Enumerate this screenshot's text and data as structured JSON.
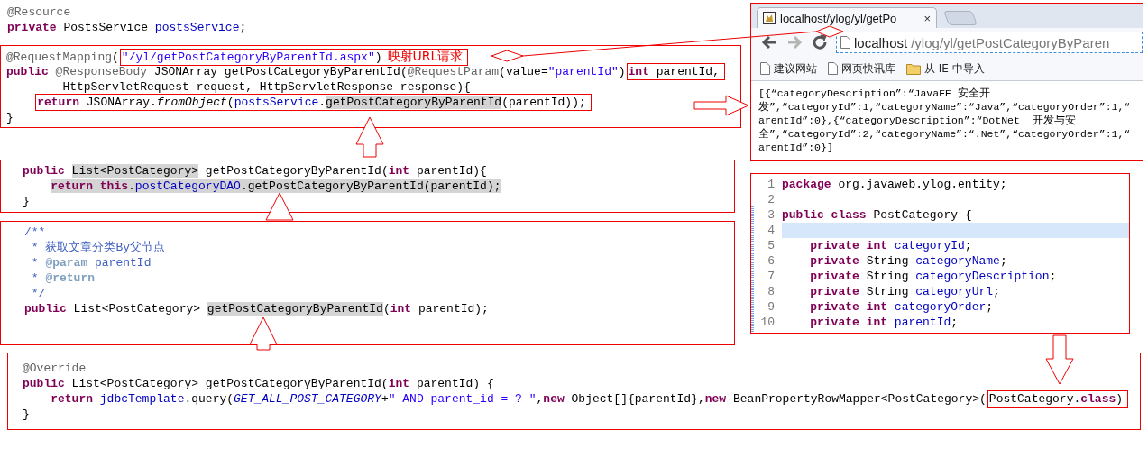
{
  "panels": [
    {
      "framed": false,
      "lines": [
        {
          "indented": false,
          "tokens": [
            {
              "text": "@Resource",
              "kind": "ann"
            }
          ]
        },
        {
          "indented": false,
          "tokens": [
            {
              "text": "private",
              "kind": "kw"
            },
            {
              "text": " PostsService ",
              "kind": "plain"
            },
            {
              "text": "postsService",
              "kind": "field"
            },
            {
              "text": ";",
              "kind": "plain"
            }
          ]
        }
      ]
    },
    {
      "framed": true,
      "lines": [
        {
          "indented": false,
          "tokens": [
            {
              "text": "@RequestMapping",
              "kind": "ann"
            },
            {
              "text": "(",
              "kind": "plain"
            },
            {
              "kind": "frame",
              "tokens": [
                {
                  "text": "\"/yl/getPostCategoryByParentId.aspx\"",
                  "kind": "str"
                },
                {
                  "text": ")",
                  "kind": "plain"
                },
                {
                  "text": "映射URL请求",
                  "kind": "note"
                }
              ]
            }
          ]
        },
        {
          "indented": false,
          "tokens": [
            {
              "text": "public ",
              "kind": "kw"
            },
            {
              "text": "@ResponseBody",
              "kind": "ann"
            },
            {
              "text": " JSONArray getPostCategoryByParentId(",
              "kind": "plain"
            },
            {
              "text": "@RequestParam",
              "kind": "ann"
            },
            {
              "text": "(value=",
              "kind": "plain"
            },
            {
              "text": "\"parentId\"",
              "kind": "str"
            },
            {
              "text": ")",
              "kind": "plain"
            },
            {
              "kind": "frame",
              "tokens": [
                {
                  "text": "int",
                  "kind": "kw"
                },
                {
                  "text": " parentId,",
                  "kind": "plain"
                }
              ]
            }
          ]
        },
        {
          "indented": false,
          "tokens": [
            {
              "text": "        HttpServletRequest request, HttpServletResponse response){",
              "kind": "plain"
            }
          ]
        },
        {
          "indented": true,
          "tokens": [
            {
              "kind": "frame",
              "tokens": [
                {
                  "text": "return",
                  "kind": "kw"
                },
                {
                  "text": " JSONArray.",
                  "kind": "plain"
                },
                {
                  "text": "fromObject",
                  "kind": "ital"
                },
                {
                  "text": "(",
                  "kind": "plain"
                },
                {
                  "text": "postsService",
                  "kind": "field"
                },
                {
                  "text": ".",
                  "kind": "plain"
                },
                {
                  "text": "getPostCategoryByParentId",
                  "kind": "mark"
                },
                {
                  "text": "(parentId));",
                  "kind": "plain"
                }
              ]
            }
          ]
        },
        {
          "indented": false,
          "tokens": [
            {
              "text": "}",
              "kind": "plain"
            }
          ]
        }
      ]
    },
    {
      "framed": true,
      "lines": [
        {
          "indented": false,
          "tokens": [
            {
              "text": "public ",
              "kind": "kw"
            },
            {
              "text": "List<PostCategory>",
              "kind": "mark"
            },
            {
              "text": " getPostCategoryByParentId(",
              "kind": "plain"
            },
            {
              "text": "int",
              "kind": "kw"
            },
            {
              "text": " parentId){",
              "kind": "plain"
            }
          ]
        },
        {
          "indented": true,
          "tokens": [
            {
              "text": "return this",
              "kind": "markkw"
            },
            {
              "text": ".",
              "kind": "mark"
            },
            {
              "text": "postCategoryDAO",
              "kind": "markfield"
            },
            {
              "text": ".getPostCategoryByParentId(parentId);",
              "kind": "mark"
            }
          ]
        },
        {
          "indented": false,
          "tokens": [
            {
              "text": "}",
              "kind": "plain"
            }
          ]
        }
      ]
    },
    {
      "framed": true,
      "lines": [
        {
          "indented": false,
          "tokens": [
            {
              "text": "/**",
              "kind": "cmt"
            }
          ]
        },
        {
          "indented": false,
          "tokens": [
            {
              "text": " * 获取文章分类By父节点",
              "kind": "cmt"
            }
          ]
        },
        {
          "indented": false,
          "tokens": [
            {
              "text": " * ",
              "kind": "cmt"
            },
            {
              "text": "@param",
              "kind": "tag"
            },
            {
              "text": " parentId",
              "kind": "cmt"
            }
          ]
        },
        {
          "indented": false,
          "tokens": [
            {
              "text": " * ",
              "kind": "cmt"
            },
            {
              "text": "@return",
              "kind": "tag"
            }
          ]
        },
        {
          "indented": false,
          "tokens": [
            {
              "text": " */",
              "kind": "cmt"
            }
          ]
        },
        {
          "indented": false,
          "tokens": [
            {
              "text": "public",
              "kind": "kw"
            },
            {
              "text": " List<PostCategory> ",
              "kind": "plain"
            },
            {
              "text": "getPostCategoryByParentId",
              "kind": "mark"
            },
            {
              "text": "(",
              "kind": "plain"
            },
            {
              "text": "int",
              "kind": "kw"
            },
            {
              "text": " parentId);",
              "kind": "plain"
            }
          ]
        }
      ]
    },
    {
      "framed": true,
      "lines": [
        {
          "indented": false,
          "tokens": [
            {
              "text": "@Override",
              "kind": "ann"
            }
          ]
        },
        {
          "indented": false,
          "tokens": [
            {
              "text": "public",
              "kind": "kw"
            },
            {
              "text": " List<PostCategory> getPostCategoryByParentId(",
              "kind": "plain"
            },
            {
              "text": "int",
              "kind": "kw"
            },
            {
              "text": " parentId) {",
              "kind": "plain"
            }
          ]
        },
        {
          "indented": true,
          "tokens": [
            {
              "text": "return ",
              "kind": "kw"
            },
            {
              "text": "jdbcTemplate",
              "kind": "field"
            },
            {
              "text": ".query(",
              "kind": "plain"
            },
            {
              "text": "GET_ALL_POST_CATEGORY",
              "kind": "const"
            },
            {
              "text": "+",
              "kind": "plain"
            },
            {
              "text": "\" AND parent_id = ? \"",
              "kind": "str"
            },
            {
              "text": ",",
              "kind": "plain"
            },
            {
              "text": "new",
              "kind": "kw"
            },
            {
              "text": " Object[]{parentId},",
              "kind": "plain"
            },
            {
              "text": "new",
              "kind": "kw"
            },
            {
              "text": " BeanPropertyRowMapper<PostCategory>(",
              "kind": "plain"
            },
            {
              "kind": "frame",
              "tokens": [
                {
                  "text": "PostCategory.",
                  "kind": "plain"
                },
                {
                  "text": "class",
                  "kind": "kw"
                },
                {
                  "text": ")",
                  "kind": "plain"
                }
              ]
            }
          ]
        },
        {
          "indented": false,
          "tokens": [
            {
              "text": "}",
              "kind": "plain"
            }
          ]
        }
      ]
    }
  ],
  "browser": {
    "tab_title": "localhost/ylog/yl/getPo",
    "tab_close": "×",
    "nav_buttons": [
      {
        "kind": "back",
        "disabled": false
      },
      {
        "kind": "forward",
        "disabled": true
      },
      {
        "kind": "reload",
        "disabled": false
      }
    ],
    "address_host": "localhost",
    "address_path": "/ylog/yl/getPostCategoryByParen",
    "bookmarks": [
      {
        "label": "建议网站",
        "kind": "page"
      },
      {
        "label": "网页快讯库",
        "kind": "page"
      },
      {
        "label": "从 IE 中导入",
        "kind": "folder"
      }
    ],
    "content_lines": [
      "[{“categoryDescription”:“JavaEE 安全开",
      "发”,“categoryId”:1,“categoryName”:“Java”,“categoryOrder”:1,“",
      "arentId”:0},{“categoryDescription”:“DotNet  开发与安",
      "全”,“categoryId”:2,“categoryName”:“.Net”,“categoryOrder”:1,“",
      "arentId”:0}]"
    ]
  },
  "editor": {
    "lines": [
      {
        "number": "1",
        "current": false,
        "tokens": [
          {
            "text": "package",
            "kind": "kw"
          },
          {
            "text": " org.javaweb.ylog.entity;",
            "kind": "plain"
          }
        ]
      },
      {
        "number": "2",
        "current": false
      },
      {
        "number": "3",
        "current": false,
        "tokens": [
          {
            "text": "public class",
            "kind": "kw"
          },
          {
            "text": " PostCategory {",
            "kind": "plain"
          }
        ]
      },
      {
        "number": "4",
        "current": true
      },
      {
        "number": "5",
        "current": false,
        "tokens": [
          {
            "text": "    private int ",
            "kind": "kw"
          },
          {
            "text": "categoryId",
            "kind": "field"
          },
          {
            "text": ";",
            "kind": "plain"
          }
        ]
      },
      {
        "number": "6",
        "current": false,
        "tokens": [
          {
            "text": "    private",
            "kind": "kw"
          },
          {
            "text": " String ",
            "kind": "plain"
          },
          {
            "text": "categoryName",
            "kind": "field"
          },
          {
            "text": ";",
            "kind": "plain"
          }
        ]
      },
      {
        "number": "7",
        "current": false,
        "tokens": [
          {
            "text": "    private",
            "kind": "kw"
          },
          {
            "text": " String ",
            "kind": "plain"
          },
          {
            "text": "categoryDescription",
            "kind": "field"
          },
          {
            "text": ";",
            "kind": "plain"
          }
        ]
      },
      {
        "number": "8",
        "current": false,
        "tokens": [
          {
            "text": "    private",
            "kind": "kw"
          },
          {
            "text": " String ",
            "kind": "plain"
          },
          {
            "text": "categoryUrl",
            "kind": "field"
          },
          {
            "text": ";",
            "kind": "plain"
          }
        ]
      },
      {
        "number": "9",
        "current": false,
        "tokens": [
          {
            "text": "    private int ",
            "kind": "kw"
          },
          {
            "text": "categoryOrder",
            "kind": "field"
          },
          {
            "text": ";",
            "kind": "plain"
          }
        ]
      },
      {
        "number": "10",
        "current": false,
        "tokens": [
          {
            "text": "    private int ",
            "kind": "kw"
          },
          {
            "text": "parentId",
            "kind": "field"
          },
          {
            "text": ";",
            "kind": "plain"
          }
        ]
      }
    ]
  }
}
